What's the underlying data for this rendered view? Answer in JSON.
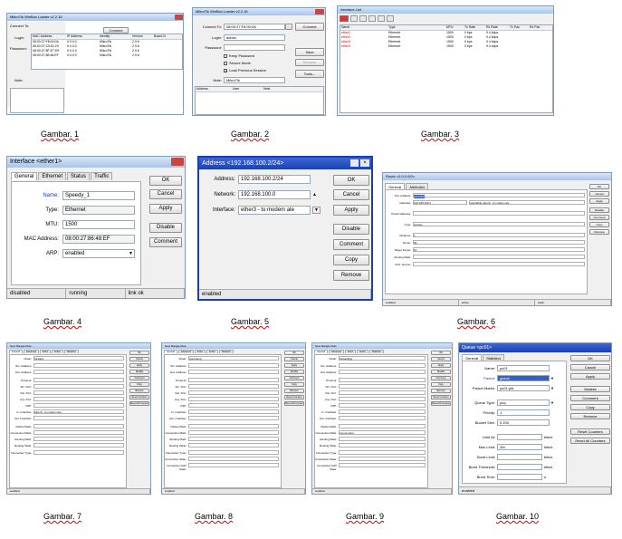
{
  "captions": [
    "Gambar. 1",
    "Gambar. 2",
    "Gambar. 3",
    "Gambar. 4",
    "Gambar. 5",
    "Gambar. 6",
    "Gambar. 7",
    "Gambar. 8",
    "Gambar. 9",
    "Gambar. 10"
  ],
  "g1": {
    "title": "MikroTik WinBox Loader v2.2.16",
    "connect_to_label": "Connect To:",
    "login_label": "Login:",
    "password_label": "Password:",
    "note_label": "Note:",
    "address_header": "Address",
    "connect_button": "Connect",
    "columns": [
      "MAC Address",
      "IP Address",
      "Identity",
      "Version",
      "Board N"
    ],
    "rows": [
      [
        "08:00:27:F8:00:0A",
        "0.0.0.0",
        "MikroTik",
        "2.9.6"
      ],
      [
        "08:00:27:C5:61:23",
        "0.0.0.0",
        "MikroTik",
        "2.9.6"
      ],
      [
        "08:00:27:8F:E7:D9",
        "0.0.0.0",
        "MikroTik",
        "2.9.6"
      ],
      [
        "08:00:27:86:48:EF",
        "0.0.0.0",
        "MikroTik",
        "2.9.6"
      ]
    ]
  },
  "g2": {
    "title": "MikroTik WinBox Loader v2.2.16",
    "connect_to_label": "Connect To:",
    "connect_to_value": "08:00:27:F8:00:0A",
    "login_label": "Login:",
    "login_value": "admin",
    "password_label": "Password:",
    "keep_password": "Keep Password",
    "secure_mode": "Secure Mode",
    "load_previous": "Load Previous Session",
    "note_label": "Note:",
    "note_value": "MikroTik",
    "connect_button": "Connect",
    "save_button": "Save",
    "remove_button": "Remove",
    "tools_button": "Tools...",
    "columns": [
      "Address",
      "User",
      "Note"
    ]
  },
  "g3": {
    "title": "Interface List",
    "columns": [
      "Name",
      "Type",
      "MTU",
      "Tx Rate",
      "Rx Rate",
      "Tx Pac",
      "Rx Pac"
    ],
    "rows": [
      [
        "ether1",
        "Ethernet",
        "1500",
        "0 bps",
        "9.4 kbps"
      ],
      [
        "ether2",
        "Ethernet",
        "1500",
        "0 bps",
        "9.4 kbps"
      ],
      [
        "ether3",
        "Ethernet",
        "1500",
        "0 bps",
        "9.4 kbps"
      ],
      [
        "ether4",
        "Ethernet",
        "1500",
        "0 bps",
        "9.4 kbps"
      ]
    ]
  },
  "g4": {
    "title": "Interface <ether1>",
    "tabs": [
      "General",
      "Ethernet",
      "Status",
      "Traffic"
    ],
    "name_label": "Name:",
    "name_value": "Speedy_1",
    "type_label": "Type:",
    "type_value": "Ethernet",
    "mtu_label": "MTU:",
    "mtu_value": "1500",
    "mac_label": "MAC Address:",
    "mac_value": "08:00:27:86:48:EF",
    "arp_label": "ARP:",
    "arp_value": "enabled",
    "buttons": [
      "OK",
      "Cancel",
      "Apply",
      "Disable",
      "Comment"
    ],
    "status": [
      "disabled",
      "running",
      "link ok"
    ]
  },
  "g5": {
    "title": "Address <192.168.100.2/24>",
    "address_label": "Address:",
    "address_value": "192.168.100.2/24",
    "network_label": "Network:",
    "network_value": "192.168.100.0",
    "interface_label": "Interface:",
    "interface_value": "ether3 - to modem ate",
    "buttons": [
      "OK",
      "Cancel",
      "Apply",
      "Disable",
      "Comment",
      "Copy",
      "Remove"
    ],
    "status": "enabled"
  },
  "g6": {
    "title": "Route <0.0.0.0/0>",
    "tabs": [
      "General",
      "Attributes"
    ],
    "dst_label": "Dst. Address:",
    "dst_value": "0.0.0.0/0",
    "gw_label": "Gateway:",
    "gw_value": "192.168.100.1",
    "gw_note": "reachable ether3 - to modem ate",
    "check_label": "Check Gateway:",
    "type_label": "Type:",
    "type_value": "unicast",
    "distance_label": "Distance:",
    "distance_value": "1",
    "scope_label": "Scope:",
    "scope_value": "30",
    "target_label": "Target Scope:",
    "target_value": "10",
    "mark_label": "Routing Mark:",
    "pref_label": "Pref. Source:",
    "buttons": [
      "OK",
      "Cancel",
      "Apply",
      "Disable",
      "Comment",
      "Copy",
      "Remove"
    ],
    "status": [
      "enabled",
      "active",
      "static"
    ]
  },
  "g7": {
    "title": "New Mangle Rule",
    "tabs": [
      "General",
      "Advanced",
      "Extra",
      "Action",
      "Statistics"
    ],
    "chain_label": "Chain:",
    "chain_value": "forward",
    "in_iface_value": "ether3 - to modem ate",
    "fields": [
      "Src. Address:",
      "Dst. Address:",
      "Protocol:",
      "Src. Port:",
      "Dst. Port:",
      "Any. Port:",
      "P2P:",
      "In. Interface:",
      "Out. Interface:",
      "Packet Mark:",
      "Connection Mark:",
      "Routing Mark:",
      "Routing Table:",
      "Connection Type:",
      "Connection State:"
    ],
    "buttons": [
      "OK",
      "Cancel",
      "Apply",
      "Disable",
      "Comment",
      "Copy",
      "Remove",
      "Reset Counters",
      "Reset All Counters"
    ],
    "status": "enabled"
  },
  "g8": {
    "title": "New Mangle Rule",
    "tabs": [
      "General",
      "Advanced",
      "Extra",
      "Action",
      "Statistics"
    ],
    "chain_value": "prerouting",
    "fields": [
      "Chain:",
      "Src. Address:",
      "Dst. Address:",
      "Protocol:",
      "Src. Port:",
      "Dst. Port:",
      "Any. Port:",
      "P2P:",
      "In. Interface:",
      "Out. Interface:",
      "Packet Mark:",
      "Connection Mark:",
      "Routing Mark:",
      "Routing Table:",
      "Connection Type:",
      "Connection State:",
      "Connection NAT State:"
    ],
    "buttons": [
      "OK",
      "Cancel",
      "Apply",
      "Disable",
      "Comment",
      "Copy",
      "Remove",
      "Reset Counters",
      "Reset All Counters"
    ],
    "status": "enabled"
  },
  "g9": {
    "title": "New Mangle Rule",
    "tabs": [
      "General",
      "Advanced",
      "Extra",
      "Action",
      "Statistics"
    ],
    "chain_value": "forwarding",
    "conn_mark_value": "conn1-trans",
    "fields": [
      "Chain:",
      "Src. Address:",
      "Dst. Address:",
      "Protocol:",
      "Src. Port:",
      "Dst. Port:",
      "Any. Port:",
      "P2P:",
      "In. Interface:",
      "Out. Interface:",
      "Packet Mark:",
      "Connection Mark:",
      "Routing Mark:",
      "Routing Table:",
      "Connection Type:",
      "Connection State:",
      "Connection NAT State:"
    ],
    "buttons": [
      "OK",
      "Cancel",
      "Apply",
      "Disable",
      "Comment",
      "Copy",
      "Remove",
      "Reset Counters",
      "Reset All Counters"
    ],
    "status": "enabled"
  },
  "g10": {
    "title": "Queue <pc01>",
    "tabs": [
      "General",
      "Statistics"
    ],
    "name_label": "Name:",
    "name_value": "pc01",
    "parent_label": "Parent:",
    "parent_value": "global",
    "pmark_label": "Packet Marks:",
    "pmark_value": "pc01-pkt",
    "qtype_label": "Queue Type:",
    "qtype_value": "pcq",
    "prio_label": "Priority:",
    "prio_value": "1",
    "bucket_label": "Bucket Size:",
    "bucket_value": "0.100",
    "limit_at_label": "Limit At:",
    "max_limit_label": "Max Limit:",
    "max_limit_value": "2M",
    "burst_limit_label": "Burst Limit:",
    "burst_thr_label": "Burst Threshold:",
    "burst_time_label": "Burst Time:",
    "unit": "bits/s",
    "unit_s": "s",
    "buttons": [
      "OK",
      "Cancel",
      "Apply",
      "Disable",
      "Comment",
      "Copy",
      "Remove",
      "Reset Counters",
      "Reset All Counters"
    ],
    "status": "enabled"
  }
}
